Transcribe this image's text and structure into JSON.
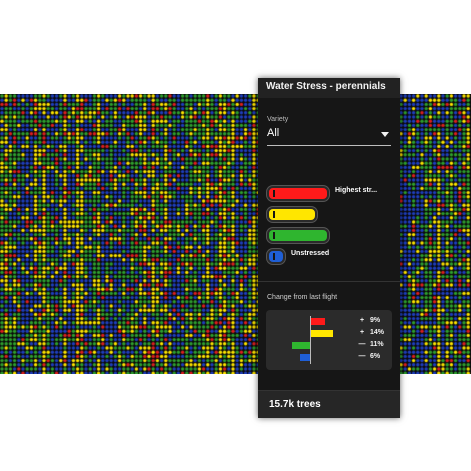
{
  "panel": {
    "title": "Water Stress - perennials",
    "variety_label": "Variety",
    "variety_value": "All",
    "legend": [
      {
        "label": "Highest str...",
        "color": "#ff1a1a",
        "length": 1.0
      },
      {
        "label": "",
        "color": "#ffe600",
        "length": 0.8
      },
      {
        "label": "",
        "color": "#2fb52f",
        "length": 1.0
      },
      {
        "label": "Unstressed",
        "color": "#1f5fd6",
        "length": 0.2
      }
    ],
    "change_label": "Change from last flight",
    "changes": [
      {
        "symbol": "+",
        "value": "9%",
        "color": "#ff1a1a",
        "direction": 1,
        "magnitude": 9
      },
      {
        "symbol": "+",
        "value": "14%",
        "color": "#ffe600",
        "direction": 1,
        "magnitude": 14
      },
      {
        "symbol": "—",
        "value": "11%",
        "color": "#2fb52f",
        "direction": -1,
        "magnitude": 11
      },
      {
        "symbol": "—",
        "value": "6%",
        "color": "#1f5fd6",
        "direction": -1,
        "magnitude": 6
      }
    ],
    "footer": "15.7k trees"
  },
  "map": {
    "colors": [
      "#1f3fbf",
      "#2fa02f",
      "#ffe600",
      "#e02020"
    ]
  }
}
